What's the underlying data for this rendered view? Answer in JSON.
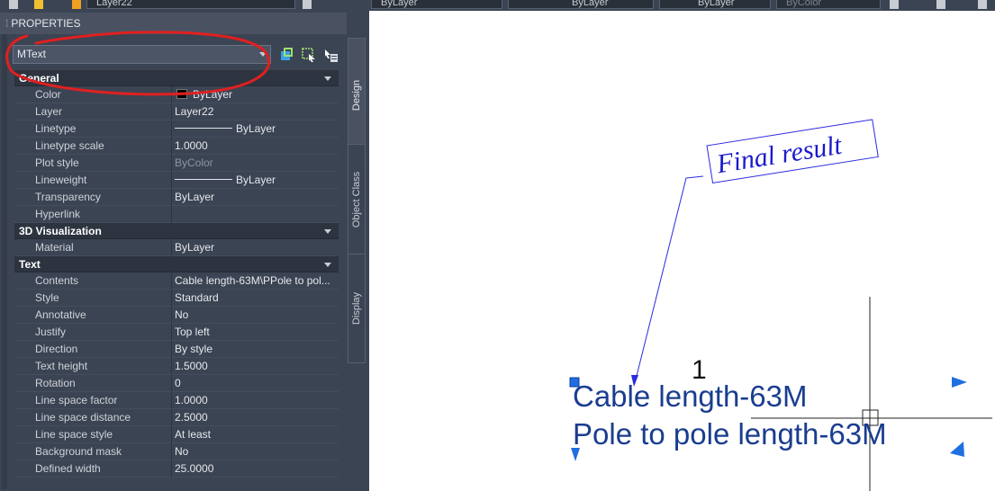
{
  "toolbar": {
    "layer_value": "Layer22",
    "color_value": "ByLayer",
    "linetype_value": "ByLayer",
    "lineweight_value": "ByLayer",
    "plotstyle_value": "ByColor"
  },
  "palette": {
    "title": "PROPERTIES",
    "object_type": "MText",
    "tabs": [
      "Design",
      "Object Class",
      "Display"
    ],
    "categories": [
      {
        "name": "General",
        "rows": [
          {
            "label": "Color",
            "value": "ByLayer"
          },
          {
            "label": "Layer",
            "value": "Layer22"
          },
          {
            "label": "Linetype",
            "value": "ByLayer"
          },
          {
            "label": "Linetype scale",
            "value": "1.0000"
          },
          {
            "label": "Plot style",
            "value": "ByColor"
          },
          {
            "label": "Lineweight",
            "value": "ByLayer"
          },
          {
            "label": "Transparency",
            "value": "ByLayer"
          },
          {
            "label": "Hyperlink",
            "value": ""
          }
        ]
      },
      {
        "name": "3D Visualization",
        "rows": [
          {
            "label": "Material",
            "value": "ByLayer"
          }
        ]
      },
      {
        "name": "Text",
        "rows": [
          {
            "label": "Contents",
            "value": "Cable length-63M\\PPole to pol..."
          },
          {
            "label": "Style",
            "value": "Standard"
          },
          {
            "label": "Annotative",
            "value": "No"
          },
          {
            "label": "Justify",
            "value": "Top left"
          },
          {
            "label": "Direction",
            "value": "By style"
          },
          {
            "label": "Text height",
            "value": "1.5000"
          },
          {
            "label": "Rotation",
            "value": "0"
          },
          {
            "label": "Line space factor",
            "value": "1.0000"
          },
          {
            "label": "Line space distance",
            "value": "2.5000"
          },
          {
            "label": "Line space style",
            "value": "At least"
          },
          {
            "label": "Background mask",
            "value": "No"
          },
          {
            "label": "Defined width",
            "value": "25.0000"
          }
        ]
      }
    ]
  },
  "drawing": {
    "callout_text": "Final result",
    "label_number": "1",
    "mtext_line1": "Cable length-63M",
    "mtext_line2": "Pole to pole length-63M",
    "colors": {
      "mtext": "#1a3d8f",
      "callout": "#1a1acc",
      "grip": "#1e6fe0",
      "annotation": "#e02020"
    }
  }
}
